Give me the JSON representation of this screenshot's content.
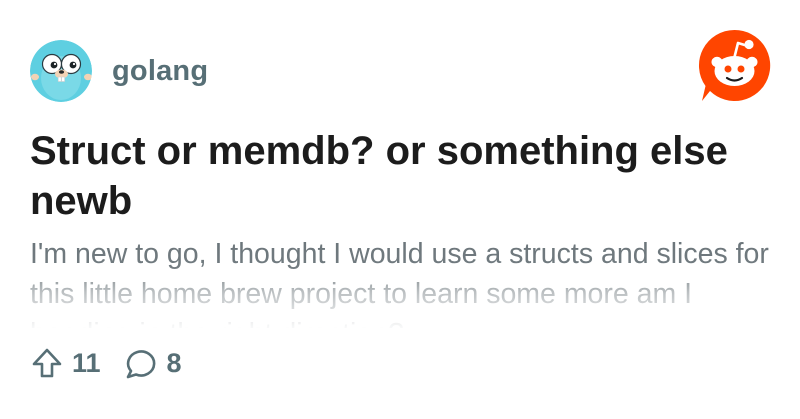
{
  "post": {
    "subreddit": "golang",
    "subreddit_icon": "gopher-icon",
    "title": "Struct or memdb? or something else newb",
    "body": "I'm new to go, I thought I would use a structs and slices for this little home brew project to learn some more am I heading in the right direction?",
    "upvotes": "11",
    "comments": "8"
  },
  "icons": {
    "brand": "reddit-logo-icon",
    "upvote": "upvote-arrow-icon",
    "comment": "comment-bubble-icon"
  },
  "colors": {
    "reddit_orange": "#ff4500",
    "gopher_blue": "#5ecfe1",
    "meta_gray": "#576f76",
    "title_text": "#1c1c1c",
    "body_text": "#6a7479"
  }
}
